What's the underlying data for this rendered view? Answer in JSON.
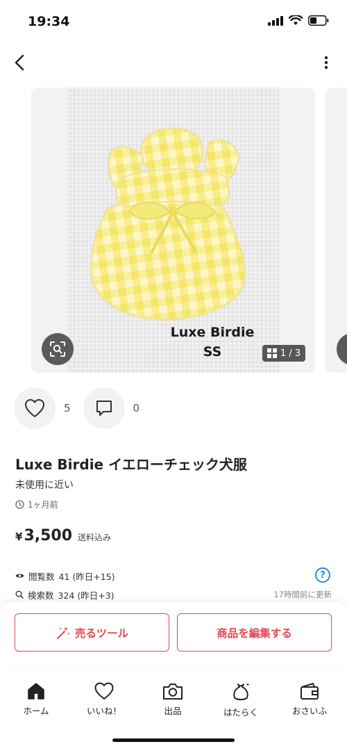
{
  "status_bar": {
    "time": "19:34"
  },
  "carousel": {
    "watermark_line1": "Luxe Birdie",
    "watermark_line2": "SS",
    "counter": "1 / 3"
  },
  "engagement": {
    "likes": "5",
    "comments": "0"
  },
  "item": {
    "title": "Luxe Birdie イエローチェック犬服",
    "condition": "未使用に近い",
    "posted": "1ヶ月前",
    "currency": "¥",
    "price": "3,500",
    "shipping": "送料込み"
  },
  "stats": {
    "views_label": "閲覧数",
    "views_value": "41 (昨日+15)",
    "search_label": "検索数",
    "search_value": "324 (昨日+3)",
    "updated": "17時間前に更新",
    "help": "?"
  },
  "actions": {
    "tools_label": "売るツール",
    "edit_label": "商品を編集する"
  },
  "tabs": [
    {
      "label": "ホーム",
      "icon": "home-icon"
    },
    {
      "label": "いいね！",
      "icon": "heart-icon"
    },
    {
      "label": "出品",
      "icon": "camera-icon"
    },
    {
      "label": "はたらく",
      "icon": "moneybag-icon"
    },
    {
      "label": "おさいふ",
      "icon": "wallet-icon"
    }
  ],
  "colors": {
    "accent": "#e64552",
    "help_blue": "#1f8fde",
    "fabric_yellow": "#f1e35a"
  }
}
